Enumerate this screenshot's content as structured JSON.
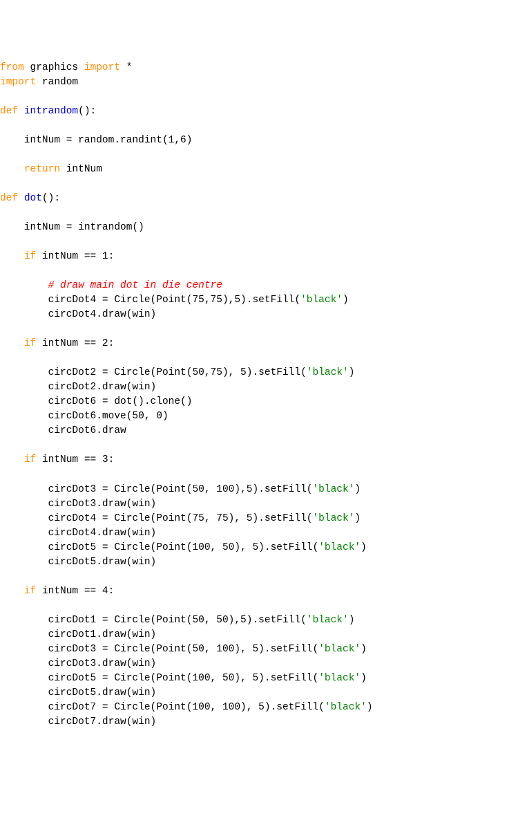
{
  "code": {
    "l01a": "from",
    "l01b": " graphics ",
    "l01c": "import",
    "l01d": " *",
    "l02a": "import",
    "l02b": " random",
    "l03": "",
    "l04a": "def",
    "l04b": " ",
    "l04c": "intrandom",
    "l04d": "():",
    "l05": "",
    "l06": "    intNum = random.randint(1,6)",
    "l07": "",
    "l08a": "    ",
    "l08b": "return",
    "l08c": " intNum",
    "l09": "",
    "l10a": "def",
    "l10b": " ",
    "l10c": "dot",
    "l10d": "():",
    "l11": "",
    "l12": "    intNum = intrandom()",
    "l13": "",
    "l14a": "    ",
    "l14b": "if",
    "l14c": " intNum == 1:",
    "l15": "",
    "l16a": "        ",
    "l16b": "# draw main dot in die centre",
    "l17a": "        circDot4 = Circle(Point(75,75),5).setFill(",
    "l17b": "'black'",
    "l17c": ")",
    "l18": "        circDot4.draw(win)",
    "l19": "",
    "l20a": "    ",
    "l20b": "if",
    "l20c": " intNum == 2:",
    "l21": "",
    "l22a": "        circDot2 = Circle(Point(50,75), 5).setFill(",
    "l22b": "'black'",
    "l22c": ")",
    "l23": "        circDot2.draw(win)",
    "l24": "        circDot6 = dot().clone()",
    "l25": "        circDot6.move(50, 0)",
    "l26": "        circDot6.draw",
    "l27": "",
    "l28a": "    ",
    "l28b": "if",
    "l28c": " intNum == 3:",
    "l29": "",
    "l30a": "        circDot3 = Circle(Point(50, 100),5).setFill(",
    "l30b": "'black'",
    "l30c": ")",
    "l31": "        circDot3.draw(win)",
    "l32a": "        circDot4 = Circle(Point(75, 75), 5).setFill(",
    "l32b": "'black'",
    "l32c": ")",
    "l33": "        circDot4.draw(win)",
    "l34a": "        circDot5 = Circle(Point(100, 50), 5).setFill(",
    "l34b": "'black'",
    "l34c": ")",
    "l35": "        circDot5.draw(win)",
    "l36": "",
    "l37a": "    ",
    "l37b": "if",
    "l37c": " intNum == 4:",
    "l38": "",
    "l39a": "        circDot1 = Circle(Point(50, 50),5).setFill(",
    "l39b": "'black'",
    "l39c": ")",
    "l40": "        circDot1.draw(win)",
    "l41a": "        circDot3 = Circle(Point(50, 100), 5).setFill(",
    "l41b": "'black'",
    "l41c": ")",
    "l42": "        circDot3.draw(win)",
    "l43a": "        circDot5 = Circle(Point(100, 50), 5).setFill(",
    "l43b": "'black'",
    "l43c": ")",
    "l44": "        circDot5.draw(win)",
    "l45a": "        circDot7 = Circle(Point(100, 100), 5).setFill(",
    "l45b": "'black'",
    "l45c": ")",
    "l46": "        circDot7.draw(win)"
  }
}
